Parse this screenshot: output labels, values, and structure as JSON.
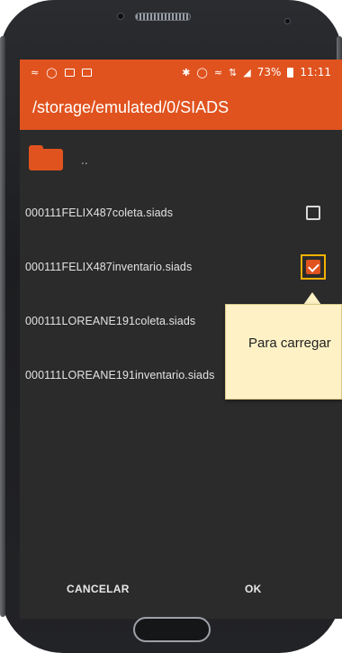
{
  "status_bar": {
    "battery_percent": "73%",
    "time": "11:11"
  },
  "app_bar": {
    "path": "/storage/emulated/0/SIADS"
  },
  "parent_folder": {
    "label": ".."
  },
  "files": [
    {
      "name": "000111FELIX487coleta.siads",
      "checked": false
    },
    {
      "name": "000111FELIX487inventario.siads",
      "checked": true
    },
    {
      "name": "000111LOREANE191coleta.siads",
      "checked": false
    },
    {
      "name": "000111LOREANE191inventario.siads",
      "checked": false
    }
  ],
  "tooltip": {
    "text": "Para carregar"
  },
  "actions": {
    "cancel_label": "CANCELAR",
    "ok_label": "OK"
  },
  "colors": {
    "accent": "#e0531f",
    "highlight": "#f5b100",
    "tooltip_bg": "#fdf1c5",
    "screen_bg": "#2b2b2b"
  }
}
